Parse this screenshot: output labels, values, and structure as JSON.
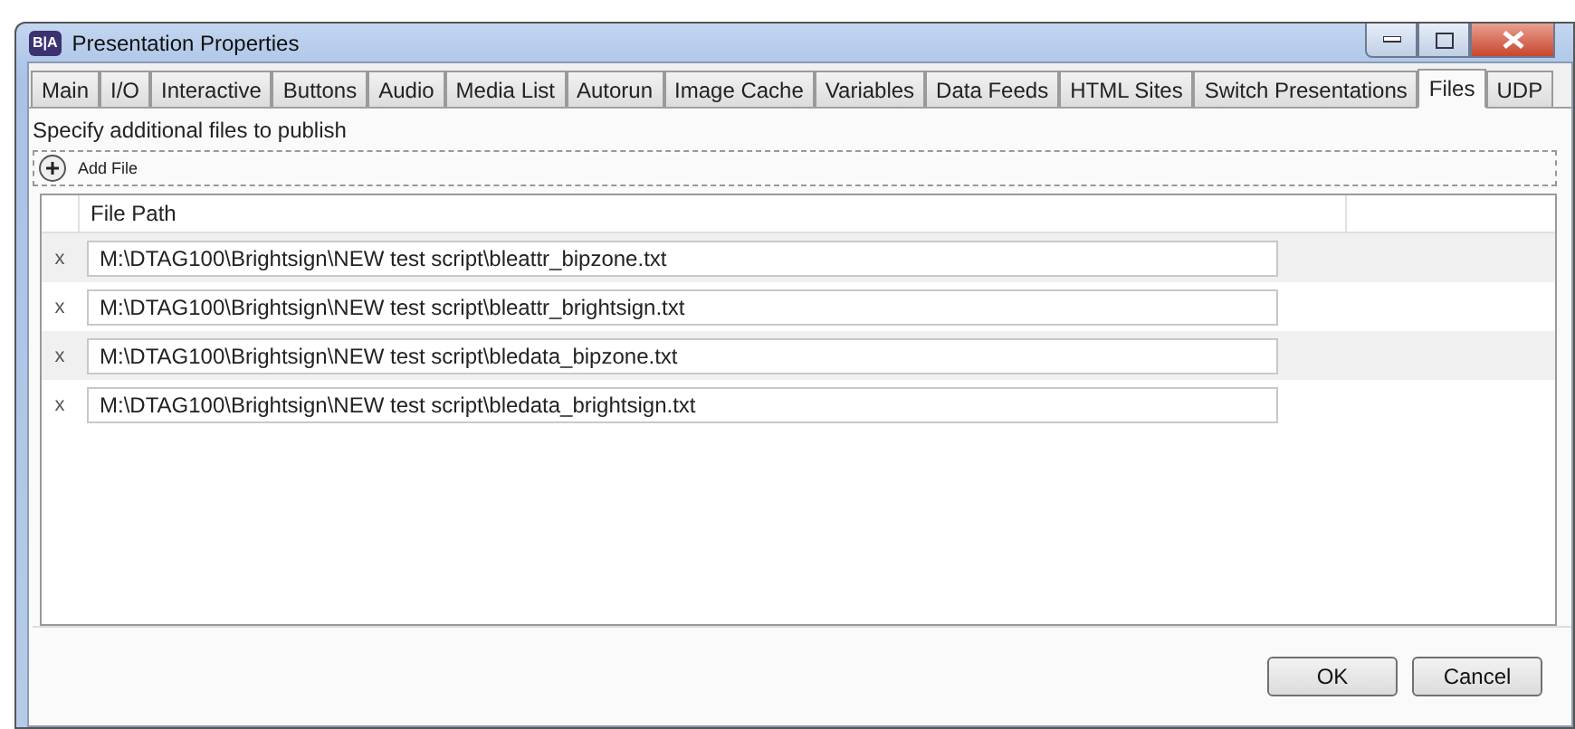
{
  "window": {
    "title": "Presentation Properties",
    "app_icon": "B|A"
  },
  "tabs": [
    {
      "label": "Main",
      "selected": false
    },
    {
      "label": "I/O",
      "selected": false
    },
    {
      "label": "Interactive",
      "selected": false
    },
    {
      "label": "Buttons",
      "selected": false
    },
    {
      "label": "Audio",
      "selected": false
    },
    {
      "label": "Media List",
      "selected": false
    },
    {
      "label": "Autorun",
      "selected": false
    },
    {
      "label": "Image Cache",
      "selected": false
    },
    {
      "label": "Variables",
      "selected": false
    },
    {
      "label": "Data Feeds",
      "selected": false
    },
    {
      "label": "HTML Sites",
      "selected": false
    },
    {
      "label": "Switch Presentations",
      "selected": false
    },
    {
      "label": "Files",
      "selected": true
    },
    {
      "label": "UDP",
      "selected": false
    }
  ],
  "instructions": "Specify additional files to publish",
  "add_button": "Add File",
  "table": {
    "columns": [
      "File Path"
    ],
    "rows": [
      {
        "remove": "x",
        "path": "M:\\DTAG100\\Brightsign\\NEW test script\\bleattr_bipzone.txt"
      },
      {
        "remove": "x",
        "path": "M:\\DTAG100\\Brightsign\\NEW test script\\bleattr_brightsign.txt"
      },
      {
        "remove": "x",
        "path": "M:\\DTAG100\\Brightsign\\NEW test script\\bledata_bipzone.txt"
      },
      {
        "remove": "x",
        "path": "M:\\DTAG100\\Brightsign\\NEW test script\\bledata_brightsign.txt"
      }
    ]
  },
  "buttons": [
    "OK",
    "Cancel"
  ]
}
